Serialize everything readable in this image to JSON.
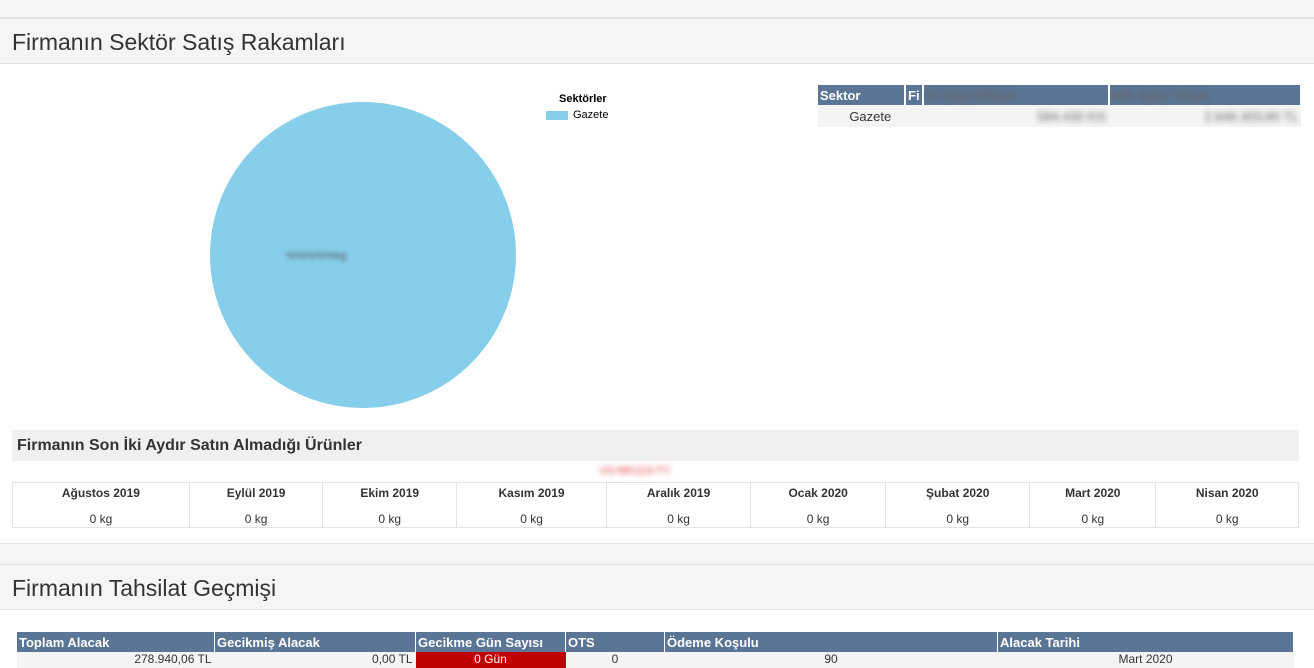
{
  "sections": {
    "sector_title": "Firmanın Sektör Satış Rakamları",
    "collection_title": "Firmanın Tahsilat Geçmişi",
    "not_purchased_title": "Firmanın Son İki Aydır Satın Almadığı Ürünler"
  },
  "chart_data": {
    "type": "pie",
    "legend_title": "Sektörler",
    "legend_position": "top-right",
    "slices": [
      {
        "label": "Gazete",
        "value": 100,
        "color": "#87ceeb",
        "slice_label": "%%%%%kg"
      }
    ]
  },
  "sector_table": {
    "headers": [
      "Sektor",
      "Fi",
      "Fi Satış Miktarı",
      "Fiili Satış Tutarı"
    ],
    "rows": [
      {
        "sector": "Gazete",
        "qty": "584.430 KG",
        "amount": "2.648.303,80 TL"
      }
    ]
  },
  "not_purchased_note": "VS-MK11S-TY",
  "months": [
    {
      "name": "Ağustos 2019",
      "value": "0 kg"
    },
    {
      "name": "Eylül 2019",
      "value": "0 kg"
    },
    {
      "name": "Ekim 2019",
      "value": "0 kg"
    },
    {
      "name": "Kasım 2019",
      "value": "0 kg"
    },
    {
      "name": "Aralık 2019",
      "value": "0 kg"
    },
    {
      "name": "Ocak 2020",
      "value": "0 kg"
    },
    {
      "name": "Şubat 2020",
      "value": "0 kg"
    },
    {
      "name": "Mart 2020",
      "value": "0 kg"
    },
    {
      "name": "Nisan 2020",
      "value": "0 kg"
    }
  ],
  "pay_table": {
    "headers": [
      "Toplam Alacak",
      "Gecikmiş Alacak",
      "Gecikme Gün Sayısı",
      "OTS",
      "Ödeme Koşulu",
      "Alacak Tarihi"
    ],
    "row": {
      "total": "278.940,06 TL",
      "overdue": "0,00 TL",
      "delay_days": "0 Gün",
      "ots": "0",
      "payment_term": "90",
      "receivable_date": "Mart 2020"
    }
  }
}
